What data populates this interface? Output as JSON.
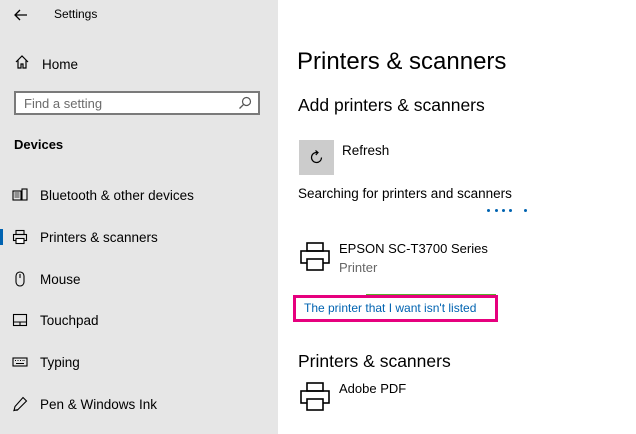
{
  "window": {
    "title": "Settings"
  },
  "sidebar": {
    "home_label": "Home",
    "search_placeholder": "Find a setting",
    "section_title": "Devices",
    "items": [
      {
        "label": "Bluetooth & other devices",
        "icon": "bluetooth-devices-icon",
        "selected": false
      },
      {
        "label": "Printers & scanners",
        "icon": "printer-icon",
        "selected": true
      },
      {
        "label": "Mouse",
        "icon": "mouse-icon",
        "selected": false
      },
      {
        "label": "Touchpad",
        "icon": "touchpad-icon",
        "selected": false
      },
      {
        "label": "Typing",
        "icon": "keyboard-icon",
        "selected": false
      },
      {
        "label": "Pen & Windows Ink",
        "icon": "pen-icon",
        "selected": false
      }
    ]
  },
  "main": {
    "title": "Printers & scanners",
    "add_heading": "Add printers & scanners",
    "refresh_label": "Refresh",
    "searching_text": "Searching for printers and scanners",
    "found_devices": [
      {
        "name": "EPSON SC-T3700 Series",
        "type": "Printer"
      }
    ],
    "not_listed_link": "The printer that I want isn't listed",
    "installed_heading": "Printers & scanners",
    "installed": [
      {
        "name": "Adobe PDF"
      }
    ]
  },
  "colors": {
    "sidebar_bg": "#e6e6e6",
    "accent": "#0063b1",
    "highlight_border": "#e6007e",
    "progress_green": "#5aae2d",
    "refresh_tile": "#cccccc"
  }
}
